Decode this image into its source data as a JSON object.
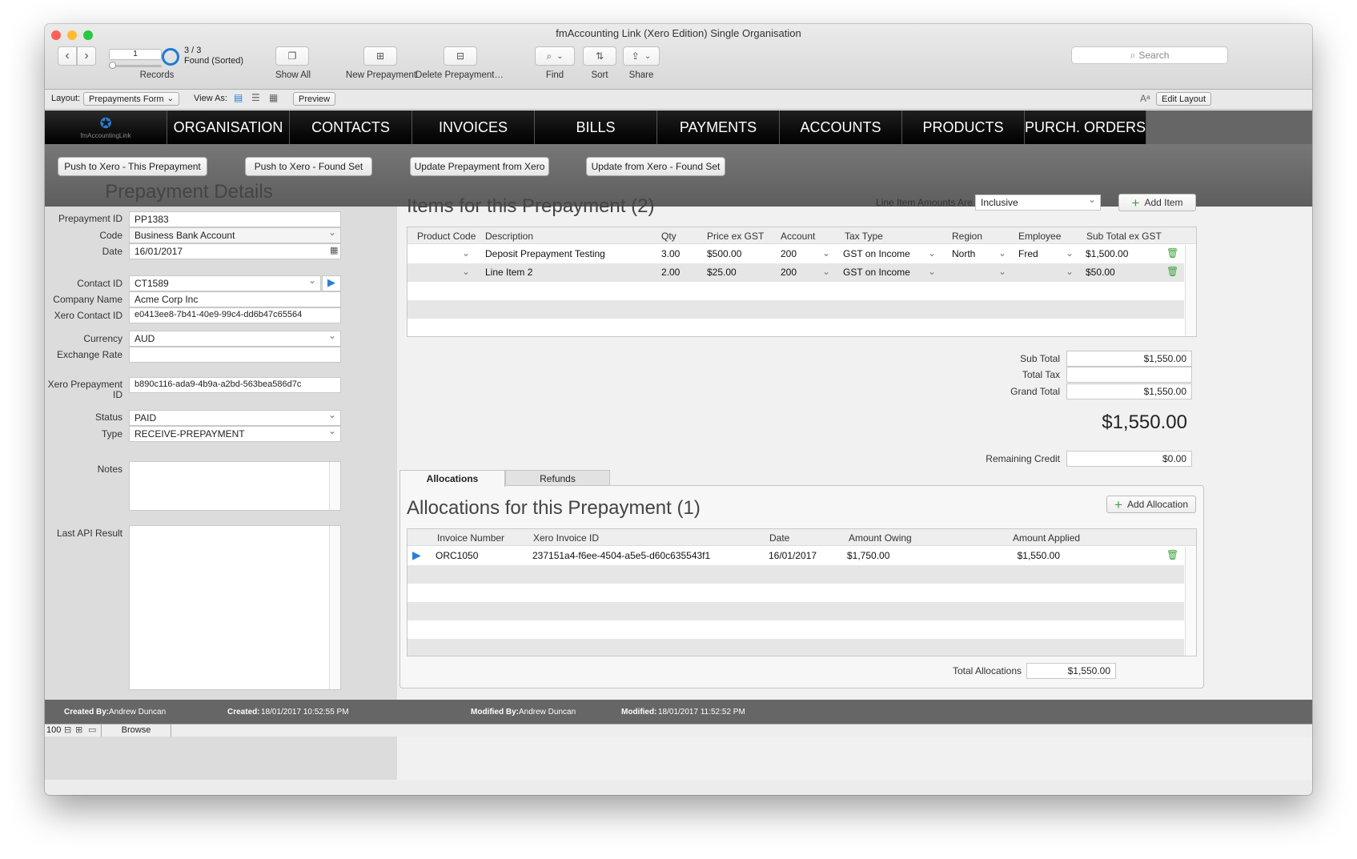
{
  "window": {
    "title": "fmAccounting Link (Xero Edition) Single Organisation"
  },
  "toolbar": {
    "record_number": "1",
    "record_count": "3 / 3",
    "found_status": "Found (Sorted)",
    "records_label": "Records",
    "show_all": "Show All",
    "new_prepayment": "New Prepayment",
    "delete_prepayment": "Delete Prepayment…",
    "find": "Find",
    "sort": "Sort",
    "share": "Share",
    "search_placeholder": "Search"
  },
  "layout_bar": {
    "layout_label": "Layout:",
    "layout_value": "Prepayments Form",
    "view_as": "View As:",
    "preview": "Preview",
    "edit_layout": "Edit Layout"
  },
  "nav": {
    "logo": "fmAccountingLink",
    "tabs": [
      "ORGANISATION",
      "CONTACTS",
      "INVOICES",
      "BILLS",
      "PAYMENTS",
      "ACCOUNTS",
      "PRODUCTS",
      "PURCH. ORDERS"
    ]
  },
  "actions": [
    "Push to Xero - This Prepayment",
    "Push to Xero - Found Set",
    "Update Prepayment from Xero",
    "Update from Xero - Found Set"
  ],
  "details": {
    "title": "Prepayment Details",
    "prepayment_id_label": "Prepayment ID",
    "prepayment_id": "PP1383",
    "code_label": "Code",
    "code": "Business Bank Account",
    "date_label": "Date",
    "date": "16/01/2017",
    "contact_id_label": "Contact ID",
    "contact_id": "CT1589",
    "company_label": "Company Name",
    "company": "Acme Corp Inc",
    "xero_contact_label": "Xero Contact ID",
    "xero_contact": "e0413ee8-7b41-40e9-99c4-dd6b47c65564",
    "currency_label": "Currency",
    "currency": "AUD",
    "exchange_label": "Exchange Rate",
    "exchange": "",
    "xero_prepayment_label_1": "Xero Prepayment",
    "xero_prepayment_label_2": "ID",
    "xero_prepayment": "b890c116-ada9-4b9a-a2bd-563bea586d7c",
    "status_label": "Status",
    "status": "PAID",
    "type_label": "Type",
    "type": "RECEIVE-PREPAYMENT",
    "notes_label": "Notes",
    "notes": "",
    "api_label": "Last API Result",
    "api": ""
  },
  "items": {
    "title": "Items for this Prepayment (2)",
    "amounts_label": "Line Item Amounts Are",
    "amounts_value": "Inclusive",
    "add_item": "Add Item",
    "headers": [
      "Product Code",
      "Description",
      "Qty",
      "Price ex GST",
      "Account",
      "Tax Type",
      "Region",
      "Employee",
      "Sub Total ex GST"
    ],
    "rows": [
      {
        "product": "",
        "description": "Deposit Prepayment Testing",
        "qty": "3.00",
        "price": "$500.00",
        "account": "200",
        "tax": "GST on Income",
        "region": "North",
        "employee": "Fred",
        "subtotal": "$1,500.00"
      },
      {
        "product": "",
        "description": "Line Item 2",
        "qty": "2.00",
        "price": "$25.00",
        "account": "200",
        "tax": "GST on Income",
        "region": "",
        "employee": "",
        "subtotal": "$50.00"
      }
    ]
  },
  "totals": {
    "sub_total_label": "Sub Total",
    "sub_total": "$1,550.00",
    "total_tax_label": "Total Tax",
    "total_tax": "",
    "grand_total_label": "Grand Total",
    "grand_total": "$1,550.00",
    "big_total": "$1,550.00",
    "remaining_label": "Remaining Credit",
    "remaining": "$0.00"
  },
  "allocations": {
    "tabs": [
      "Allocations",
      "Refunds"
    ],
    "title": "Allocations for this Prepayment (1)",
    "add_allocation": "Add Allocation",
    "headers": [
      "Invoice Number",
      "Xero Invoice ID",
      "Date",
      "Amount Owing",
      "Amount Applied"
    ],
    "rows": [
      {
        "invoice": "ORC1050",
        "xero_id": "237151a4-f6ee-4504-a5e5-d60c635543f1",
        "date": "16/01/2017",
        "owing": "$1,750.00",
        "applied": "$1,550.00"
      }
    ],
    "total_label": "Total Allocations",
    "total": "$1,550.00"
  },
  "status_bar": {
    "created_by_label": "Created By:",
    "created_by": "Andrew Duncan",
    "created_label": "Created:",
    "created": "18/01/2017 10:52:55 PM",
    "modified_by_label": "Modified By:",
    "modified_by": "Andrew Duncan",
    "modified_label": "Modified:",
    "modified": "18/01/2017 11:52:52 PM"
  },
  "bottom": {
    "zoom": "100",
    "mode": "Browse"
  },
  "colors": {
    "accent_blue": "#2a7fd4",
    "nav_bg": "#111111",
    "add_green": "#3fa13f"
  }
}
